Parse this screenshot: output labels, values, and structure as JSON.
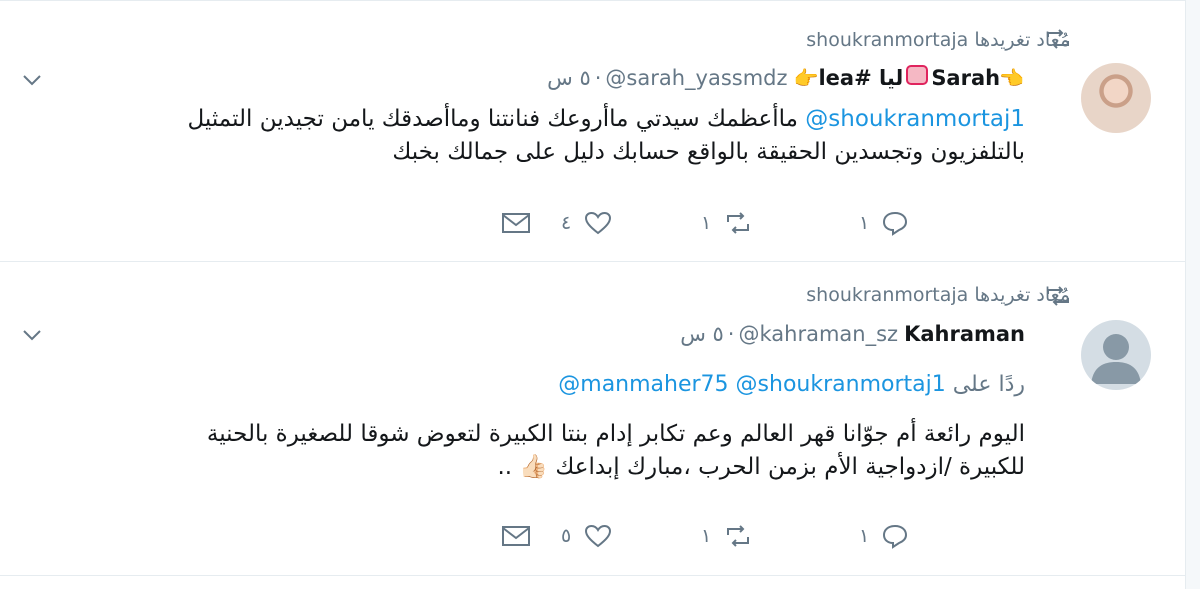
{
  "feed": {
    "tweets": [
      {
        "retweet_context": "shoukranmortaja مُعاد تغريدها",
        "name": "Sarah",
        "name_extra": "ليا #lea",
        "handle": "@sarah_yassmdz",
        "separator": "·",
        "time": "٥ س",
        "mention": "@shoukranmortaj1",
        "text_line1": "ماأعظمك سيدتي ماأروعك فنانتنا وماأصدقك يامن تجيدين التمثيل",
        "text_line2": "بالتلفزيون وتجسدين الحقيقة بالواقع حسابك دليل على جمالك بخبك",
        "reply_count": "١",
        "retweet_count": "١",
        "like_count": "٤",
        "avatar": "profile-photo"
      },
      {
        "retweet_context": "shoukranmortaja مُعاد تغريدها",
        "name": "Kahraman",
        "handle": "@kahraman_sz",
        "separator": "·",
        "time": "٥ س",
        "reply_to_label": "ردًا على",
        "reply_to_mentions": "@manmaher75 @shoukranmortaj1",
        "text_line1": "اليوم رائعة أم جوّانا قهر العالم وعم تكابر إدام بنتا الكبيرة لتعوض شوقا للصغيرة بالحنية",
        "text_line2": "للكبيرة /ازدواجية الأم بزمن الحرب ،مبارك إبداعك 👍🏻 ..",
        "reply_count": "١",
        "retweet_count": "١",
        "like_count": "٥",
        "avatar": "default-avatar"
      }
    ]
  },
  "icons": {
    "retweet": "retweet-icon",
    "reply": "reply-icon",
    "like": "heart-icon",
    "dm": "envelope-icon",
    "menu": "chevron-down-icon",
    "emoji_point": "pointing-hand-emoji",
    "emoji_heart": "heart-emoji"
  },
  "colors": {
    "link": "#1b95e0",
    "secondary_text": "#657786",
    "divider": "#e6ecf0"
  }
}
